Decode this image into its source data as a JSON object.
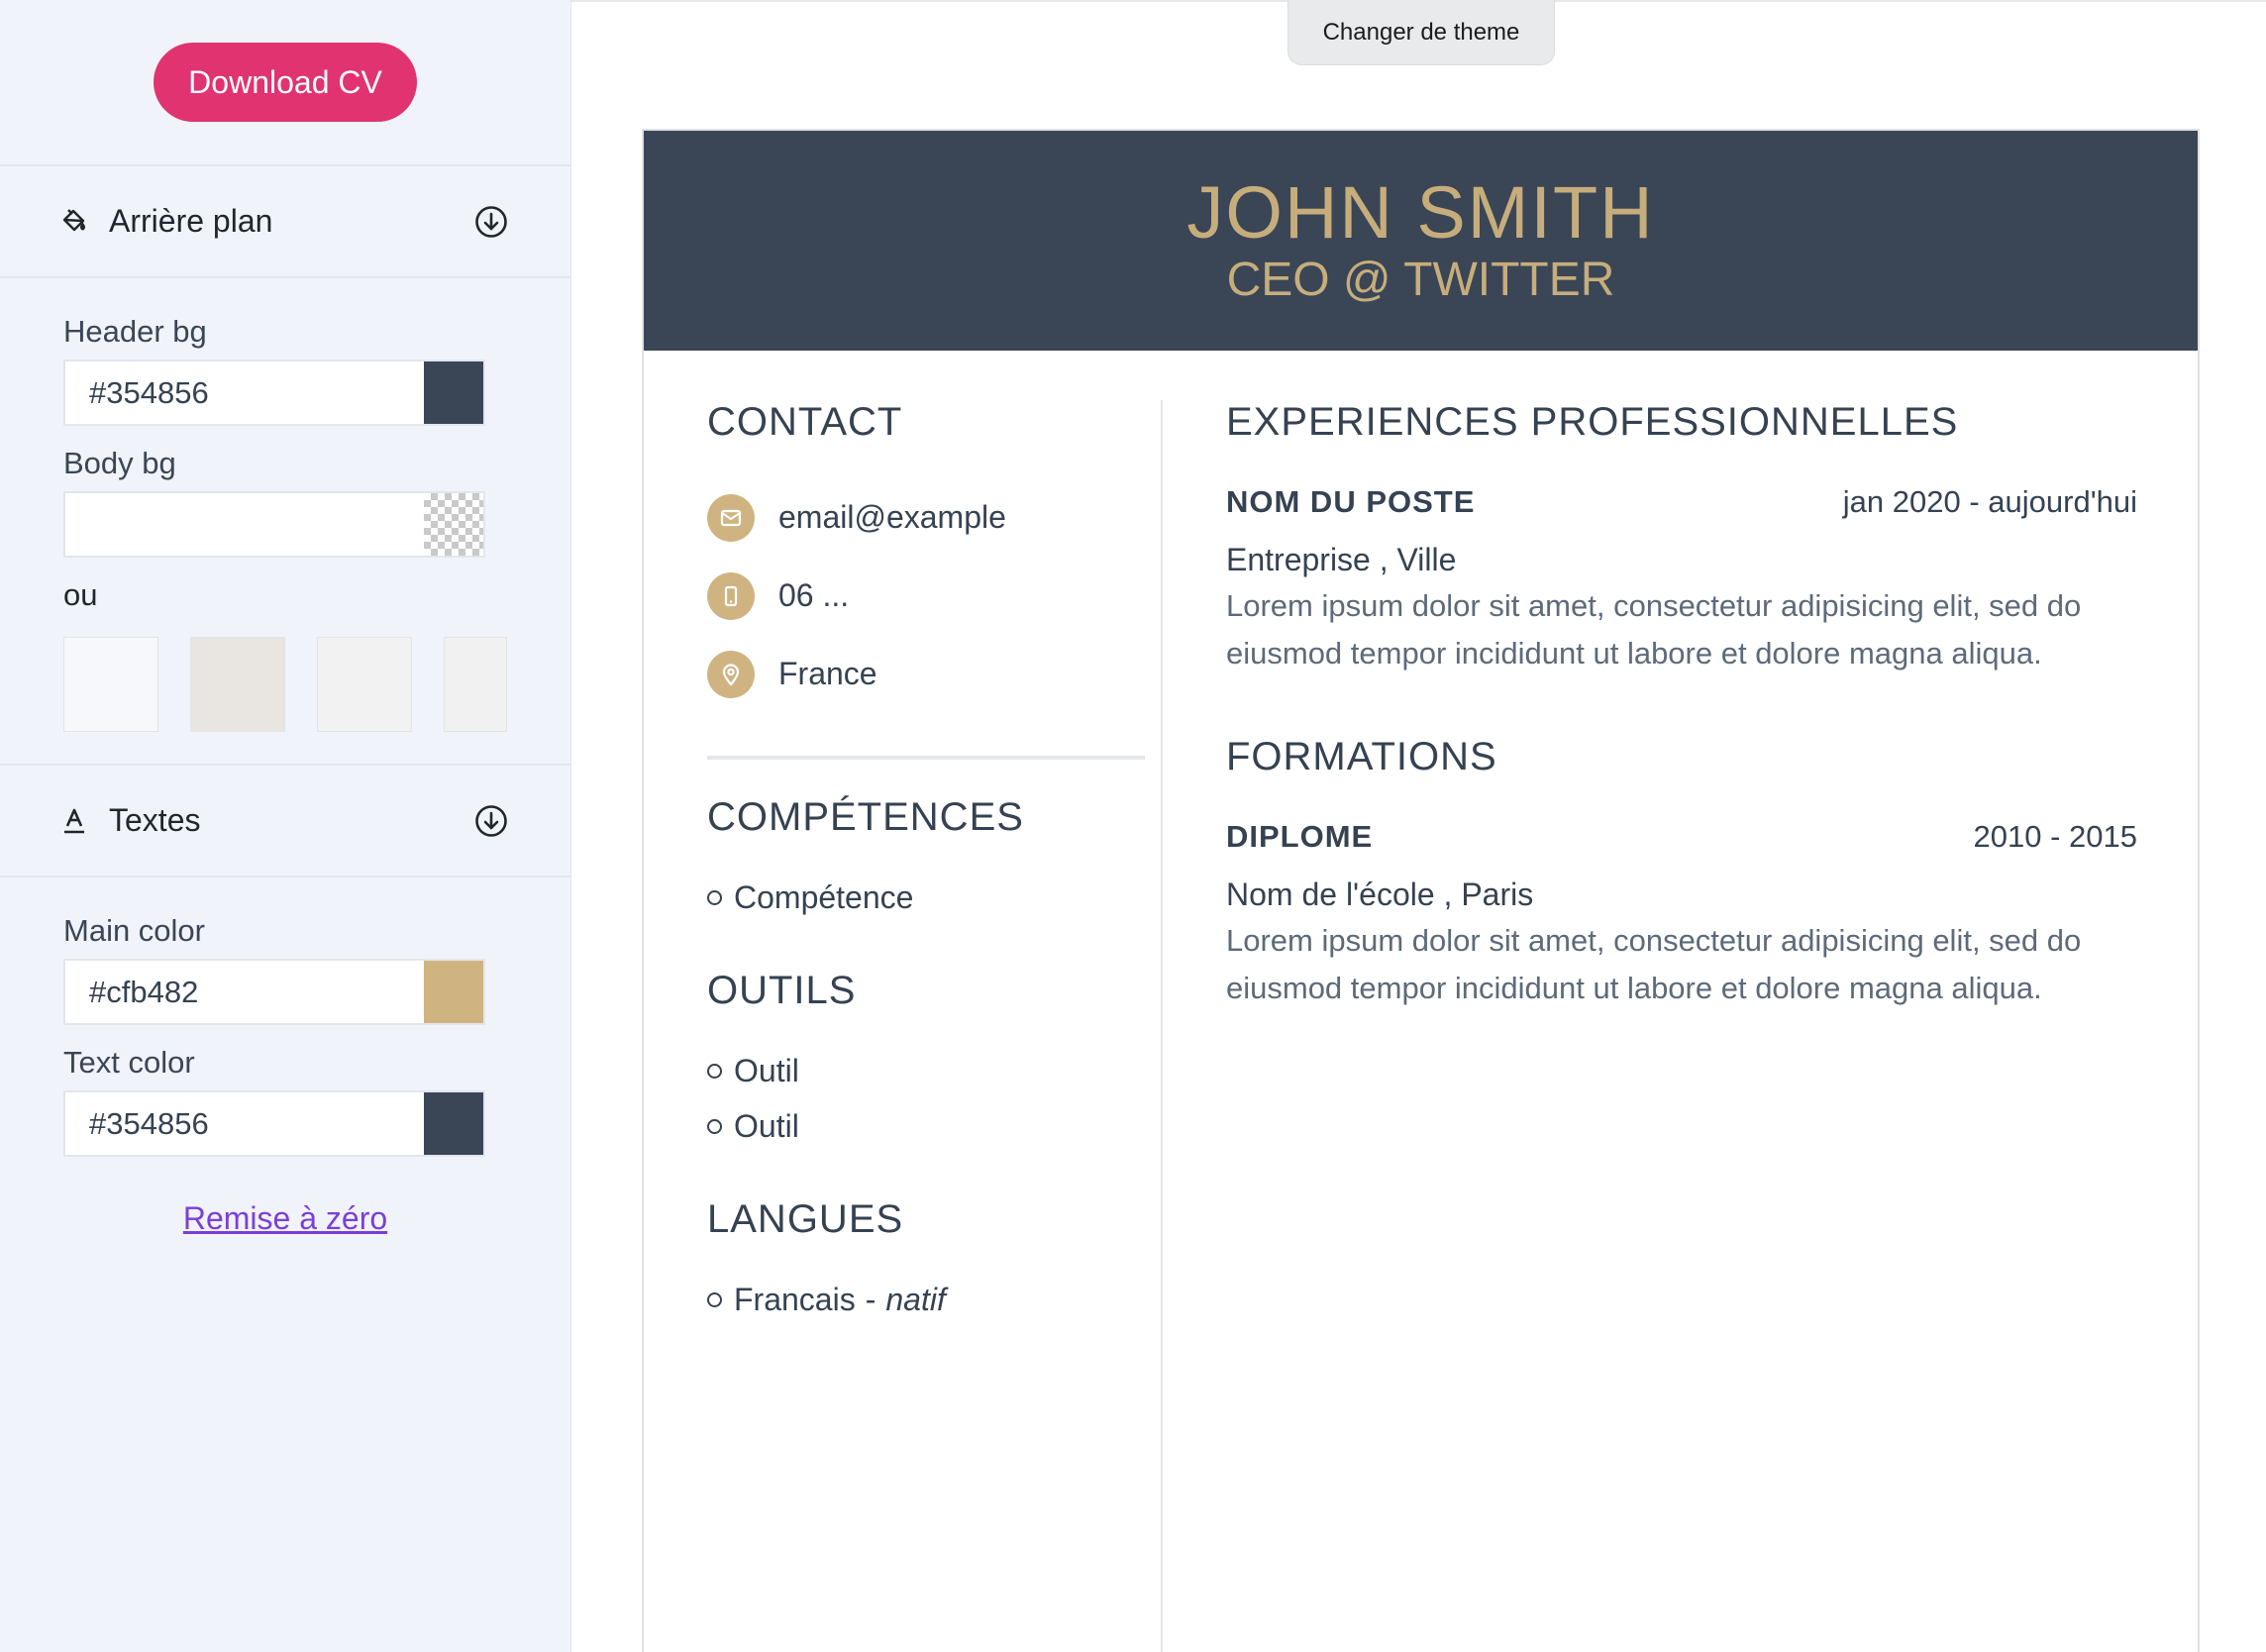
{
  "sidebar": {
    "download_label": "Download CV",
    "background_section": {
      "title": "Arrière plan",
      "header_bg": {
        "label": "Header bg",
        "value": "#354856",
        "swatch": "#3a4656"
      },
      "body_bg": {
        "label": "Body bg",
        "value": ""
      },
      "or_label": "ou",
      "textures": [
        "#f6f8fb",
        "#e9e6e2",
        "#f3f2f2",
        "#f1f1f1"
      ]
    },
    "text_section": {
      "title": "Textes",
      "main_color": {
        "label": "Main color",
        "value": "#cfb482",
        "swatch": "#cfb482"
      },
      "text_color": {
        "label": "Text color",
        "value": "#354856",
        "swatch": "#3a4656"
      },
      "reset_label": "Remise à zéro"
    }
  },
  "theme_button": "Changer de theme",
  "cv": {
    "name": "JOHN SMITH",
    "role": "CEO @ TWITTER",
    "contact": {
      "heading": "CONTACT",
      "email": "email@example",
      "phone": "06 ...",
      "location": "France"
    },
    "skills": {
      "heading": "COMPÉTENCES",
      "items": [
        "Compétence"
      ]
    },
    "tools": {
      "heading": "OUTILS",
      "items": [
        "Outil",
        "Outil"
      ]
    },
    "languages": {
      "heading": "LANGUES",
      "items": [
        {
          "name": "Francais",
          "sep": "-",
          "level": "natif"
        }
      ]
    },
    "experience": {
      "heading": "EXPERIENCES PROFESSIONNELLES",
      "title": "NOM DU POSTE",
      "date": "jan 2020 - aujourd'hui",
      "company": "Entreprise , Ville",
      "description": "Lorem ipsum dolor sit amet, consectetur adipisicing elit, sed do eiusmod tempor incididunt ut labore et dolore magna aliqua."
    },
    "education": {
      "heading": "FORMATIONS",
      "title": "DIPLOME",
      "date": "2010 - 2015",
      "school": "Nom de l'école , Paris",
      "description": "Lorem ipsum dolor sit amet, consectetur adipisicing elit, sed do eiusmod tempor incididunt ut labore et dolore magna aliqua."
    }
  },
  "colors": {
    "accent_pink": "#e03370",
    "header": "#3a4656",
    "gold": "#cfb482",
    "link": "#7b3fd9"
  },
  "icons": [
    "paint-bucket-icon",
    "arrow-down-circle-icon",
    "text-color-icon",
    "envelope-icon",
    "phone-icon",
    "map-pin-icon"
  ]
}
